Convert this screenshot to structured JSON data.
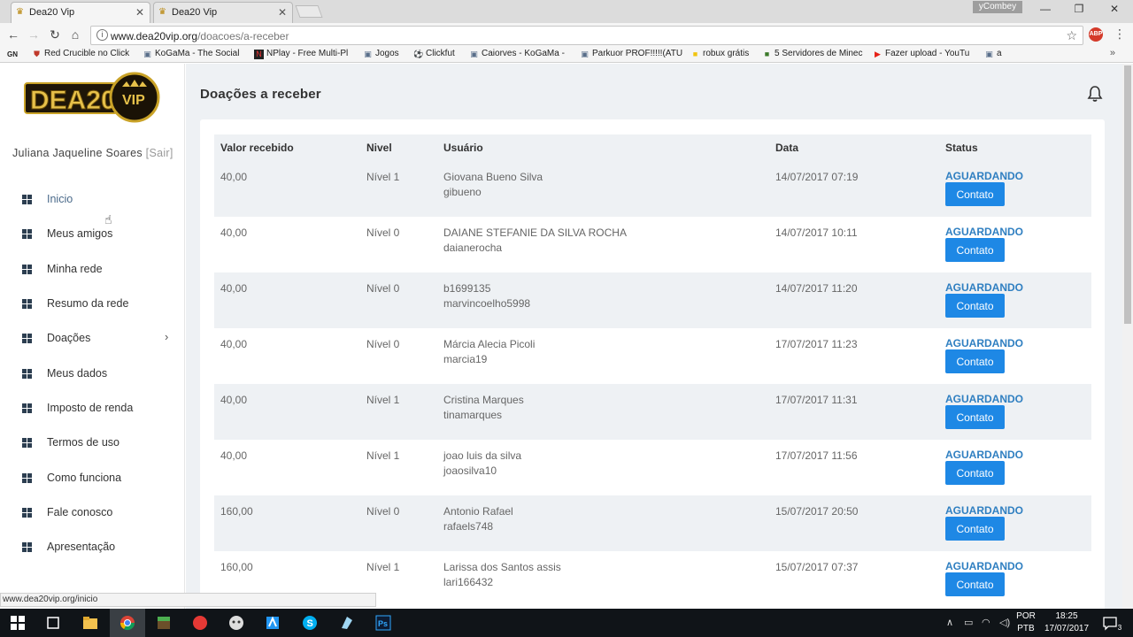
{
  "browser": {
    "tabs": [
      {
        "title": "Dea20 Vip",
        "active": true
      },
      {
        "title": "Dea20 Vip",
        "active": false
      }
    ],
    "profile": "yCombey",
    "url_host": "www.dea20vip.org",
    "url_path": "/doacoes/a-receber",
    "abp_label": "ABP",
    "bookmarks": [
      {
        "label": "Red Crucible no Click",
        "icon": "shield-icon"
      },
      {
        "label": "KoGaMa - The Social",
        "icon": "kogama-icon"
      },
      {
        "label": "NPlay - Free Multi-Pl",
        "icon": "nplay-icon"
      },
      {
        "label": "Jogos",
        "icon": "kogama-icon"
      },
      {
        "label": "Clickfut",
        "icon": "ball-icon"
      },
      {
        "label": "Caiorves - KoGaMa -",
        "icon": "kogama-icon"
      },
      {
        "label": "Parkuor PROF!!!!!(ATU",
        "icon": "kogama-icon"
      },
      {
        "label": "robux grátis",
        "icon": "folder-icon"
      },
      {
        "label": "5 Servidores de Minec",
        "icon": "minecraft-icon"
      },
      {
        "label": "Fazer upload - YouTu",
        "icon": "youtube-icon"
      },
      {
        "label": "a",
        "icon": "kogama-icon"
      }
    ],
    "status_url": "www.dea20vip.org/inicio"
  },
  "sidebar": {
    "logo_text": "DEA20",
    "logo_badge": "VIP",
    "user_name": "Juliana Jaqueline Soares",
    "logout_label": "[Sair]",
    "items": [
      {
        "label": "Inicio",
        "has_submenu": false
      },
      {
        "label": "Meus amigos",
        "has_submenu": false
      },
      {
        "label": "Minha rede",
        "has_submenu": false
      },
      {
        "label": "Resumo da rede",
        "has_submenu": false
      },
      {
        "label": "Doações",
        "has_submenu": true
      },
      {
        "label": "Meus dados",
        "has_submenu": false
      },
      {
        "label": "Imposto de renda",
        "has_submenu": false
      },
      {
        "label": "Termos de uso",
        "has_submenu": false
      },
      {
        "label": "Como funciona",
        "has_submenu": false
      },
      {
        "label": "Fale conosco",
        "has_submenu": false
      },
      {
        "label": "Apresentação",
        "has_submenu": false
      }
    ]
  },
  "main": {
    "title": "Doações a receber",
    "columns": [
      "Valor recebido",
      "Nivel",
      "Usuário",
      "Data",
      "Status"
    ],
    "contact_label": "Contato",
    "rows": [
      {
        "valor": "40,00",
        "nivel": "Nível 1",
        "nome": "Giovana Bueno Silva",
        "login": "gibueno",
        "data": "14/07/2017 07:19",
        "status": "AGUARDANDO"
      },
      {
        "valor": "40,00",
        "nivel": "Nível 0",
        "nome": "DAIANE STEFANIE DA SILVA ROCHA",
        "login": "daianerocha",
        "data": "14/07/2017 10:11",
        "status": "AGUARDANDO"
      },
      {
        "valor": "40,00",
        "nivel": "Nível 0",
        "nome": "b1699135",
        "login": "marvincoelho5998",
        "data": "14/07/2017 11:20",
        "status": "AGUARDANDO"
      },
      {
        "valor": "40,00",
        "nivel": "Nível 0",
        "nome": "Márcia Alecia Picoli",
        "login": "marcia19",
        "data": "17/07/2017 11:23",
        "status": "AGUARDANDO"
      },
      {
        "valor": "40,00",
        "nivel": "Nível 1",
        "nome": "Cristina Marques",
        "login": "tinamarques",
        "data": "17/07/2017 11:31",
        "status": "AGUARDANDO"
      },
      {
        "valor": "40,00",
        "nivel": "Nível 1",
        "nome": "joao luis da silva",
        "login": "joaosilva10",
        "data": "17/07/2017 11:56",
        "status": "AGUARDANDO"
      },
      {
        "valor": "160,00",
        "nivel": "Nível 0",
        "nome": "Antonio Rafael",
        "login": "rafaels748",
        "data": "15/07/2017 20:50",
        "status": "AGUARDANDO"
      },
      {
        "valor": "160,00",
        "nivel": "Nível 1",
        "nome": "Larissa dos Santos assis",
        "login": "lari166432",
        "data": "15/07/2017 07:37",
        "status": "AGUARDANDO"
      }
    ]
  },
  "taskbar": {
    "lang": "POR",
    "layout": "PTB",
    "time": "18:25",
    "date": "17/07/2017",
    "notifications": "3"
  },
  "colors": {
    "accent": "#1e88e5",
    "status": "#2f7fc1",
    "row_stripe": "#eef1f4"
  }
}
